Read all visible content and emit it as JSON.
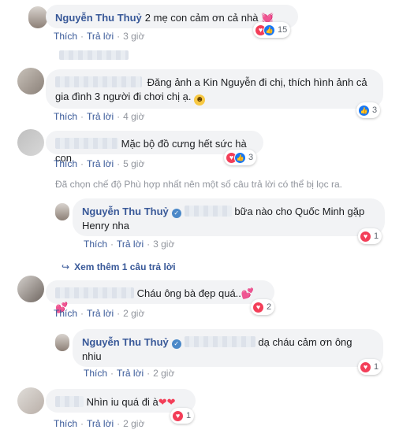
{
  "comments": [
    {
      "author": "Nguyễn Thu Thuỷ",
      "text": "2 mẹ con cảm ơn cả nhà",
      "emoji": "💓",
      "actions": {
        "like": "Thích",
        "reply": "Trả lời",
        "time": "3 giờ"
      },
      "reactions": {
        "count": "15",
        "types": [
          "love-icon",
          "like-icon"
        ]
      }
    },
    {
      "author": "",
      "text": "Đăng ảnh a Kin Nguyễn đi chị, thích hình ảnh cả gia đình 3 người đi chơi chị ạ.",
      "emoji": "😊",
      "actions": {
        "like": "Thích",
        "reply": "Trả lời",
        "time": "4 giờ"
      },
      "reactions": {
        "count": "3",
        "types": [
          "like-icon"
        ]
      }
    },
    {
      "author": "",
      "text": "Mặc bộ đồ cưng hết sức hà con",
      "actions": {
        "like": "Thích",
        "reply": "Trả lời",
        "time": "5 giờ"
      },
      "reactions": {
        "count": "3",
        "types": [
          "love-icon",
          "like-icon"
        ]
      }
    },
    {
      "author": "",
      "text": "Cháu ông bà đẹp quá..",
      "emoji": "💕💕",
      "actions": {
        "like": "Thích",
        "reply": "Trả lời",
        "time": "2 giờ"
      },
      "reactions": {
        "count": "2",
        "types": [
          "love-icon"
        ]
      }
    },
    {
      "author": "",
      "text": "Nhìn iu quá đi à",
      "emoji": "❤❤",
      "actions": {
        "like": "Thích",
        "reply": "Trả lời",
        "time": "2 giờ"
      },
      "reactions": {
        "count": "1",
        "types": [
          "love-icon"
        ]
      }
    }
  ],
  "replies": [
    {
      "author": "Nguyễn Thu Thuỷ",
      "text": "bữa nào cho Quốc Minh gặp Henry nha",
      "actions": {
        "like": "Thích",
        "reply": "Trả lời",
        "time": "3 giờ"
      },
      "reactions": {
        "count": "1",
        "types": [
          "love-icon"
        ]
      }
    },
    {
      "author": "Nguyễn Thu Thuỷ",
      "text": "dạ cháu cảm ơn ông nhiu",
      "actions": {
        "like": "Thích",
        "reply": "Trả lời",
        "time": "2 giờ"
      },
      "reactions": {
        "count": "1",
        "types": [
          "love-icon"
        ]
      }
    }
  ],
  "filter_note": "Đã chọn chế độ Phù hợp nhất nên một số câu trả lời có thể bị lọc ra.",
  "view_more": "Xem thêm 1 câu trả lời",
  "colors": {
    "link": "#385898",
    "bubble": "#f2f3f5",
    "love": "#f33e58",
    "like": "#1877f2",
    "meta": "#90949c"
  }
}
